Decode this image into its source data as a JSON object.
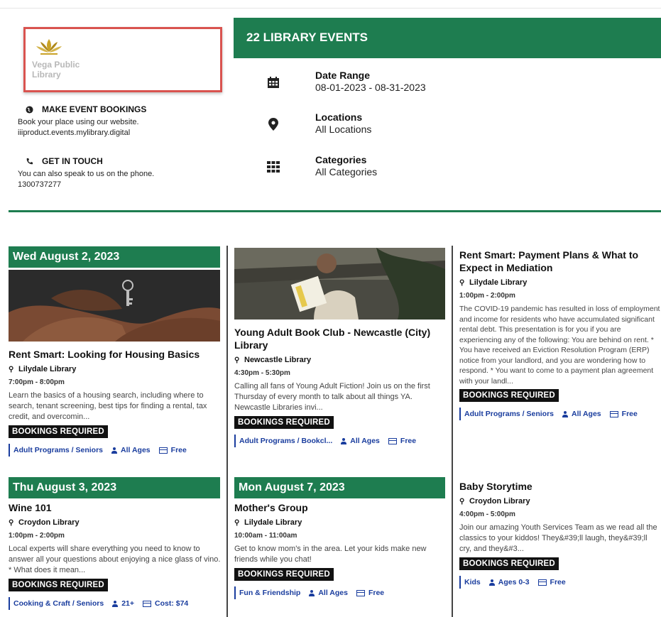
{
  "logo": {
    "line1": "Vega Public",
    "line2": "Library"
  },
  "contact": {
    "bookings": {
      "icon": "globe-icon",
      "heading": "MAKE EVENT BOOKINGS",
      "line1": "Book your place using our website.",
      "line2": "iiiproduct.events.mylibrary.digital"
    },
    "phone": {
      "icon": "phone-icon",
      "heading": "GET IN TOUCH",
      "line1": "You can also speak to us on the phone.",
      "line2": "1300737277"
    }
  },
  "summary": {
    "title": "22 LIBRARY EVENTS",
    "filters": [
      {
        "icon": "calendar-icon",
        "label": "Date Range",
        "value": "08-01-2023 - 08-31-2023"
      },
      {
        "icon": "location-pin-icon",
        "label": "Locations",
        "value": "All Locations"
      },
      {
        "icon": "grid-icon",
        "label": "Categories",
        "value": "All Categories"
      }
    ]
  },
  "colors": {
    "brand_green": "#1e7d50",
    "tag_blue": "#1a3d9e",
    "highlight_red": "#d9534f"
  },
  "days": [
    {
      "label": "Wed August 2, 2023"
    },
    {
      "label": "Thu August 3, 2023"
    },
    {
      "label": "Mon August 7, 2023"
    }
  ],
  "events": [
    {
      "title": "Rent Smart: Looking for Housing Basics",
      "location": "Lilydale Library",
      "time": "7:00pm - 8:00pm",
      "desc": "Learn the basics of a housing search, including where to search, tenant screening, best tips for finding a rental, tax credit, and overcomin...",
      "badge": "BOOKINGS REQUIRED",
      "category": "Adult Programs / Seniors",
      "age": "All Ages",
      "cost": "Free"
    },
    {
      "title": "Young Adult Book Club - Newcastle (City) Library",
      "location": "Newcastle Library",
      "time": "4:30pm - 5:30pm",
      "desc": "Calling all fans of Young Adult Fiction! Join us on the first Thursday of every month to talk about all things YA. Newcastle Libraries invi...",
      "badge": "BOOKINGS REQUIRED",
      "category": "Adult Programs / Bookcl...",
      "age": "All Ages",
      "cost": "Free"
    },
    {
      "title": "Rent Smart: Payment Plans & What to Expect in Mediation",
      "location": "Lilydale Library",
      "time": "1:00pm - 2:00pm",
      "desc": "The COVID-19 pandemic has resulted in loss of employment and income for residents who have accumulated significant rental debt. This presentation is for you if you are experiencing any of the following: You are behind on rent. * You have received an Eviction Resolution Program (ERP) notice from your landlord, and you are wondering how to respond. * You want to come to a payment plan agreement with your landl...",
      "badge": "BOOKINGS REQUIRED",
      "category": "Adult Programs / Seniors",
      "age": "All Ages",
      "cost": "Free"
    },
    {
      "title": "Wine 101",
      "location": "Croydon Library",
      "time": "1:00pm - 2:00pm",
      "desc": "Local experts will share everything you need to know to answer all your questions about enjoying a nice glass of vino. * What does it mean...",
      "badge": "BOOKINGS REQUIRED",
      "category": "Cooking & Craft / Seniors",
      "age": "21+",
      "cost": "Cost: $74"
    },
    {
      "title": "Mother's Group",
      "location": "Lilydale Library",
      "time": "10:00am - 11:00am",
      "desc": "Get to know mom's in the area. Let your kids make new friends while you chat!",
      "badge": "BOOKINGS REQUIRED",
      "category": "Fun & Friendship",
      "age": "All Ages",
      "cost": "Free"
    },
    {
      "title": "Baby Storytime",
      "location": "Croydon Library",
      "time": "4:00pm - 5:00pm",
      "desc": "Join our amazing Youth Services Team as we read all the classics to your kiddos! They&#39;ll laugh, they&#39;ll cry, and they&#3...",
      "badge": "BOOKINGS REQUIRED",
      "category": "Kids",
      "age": "Ages 0-3",
      "cost": "Free"
    }
  ]
}
